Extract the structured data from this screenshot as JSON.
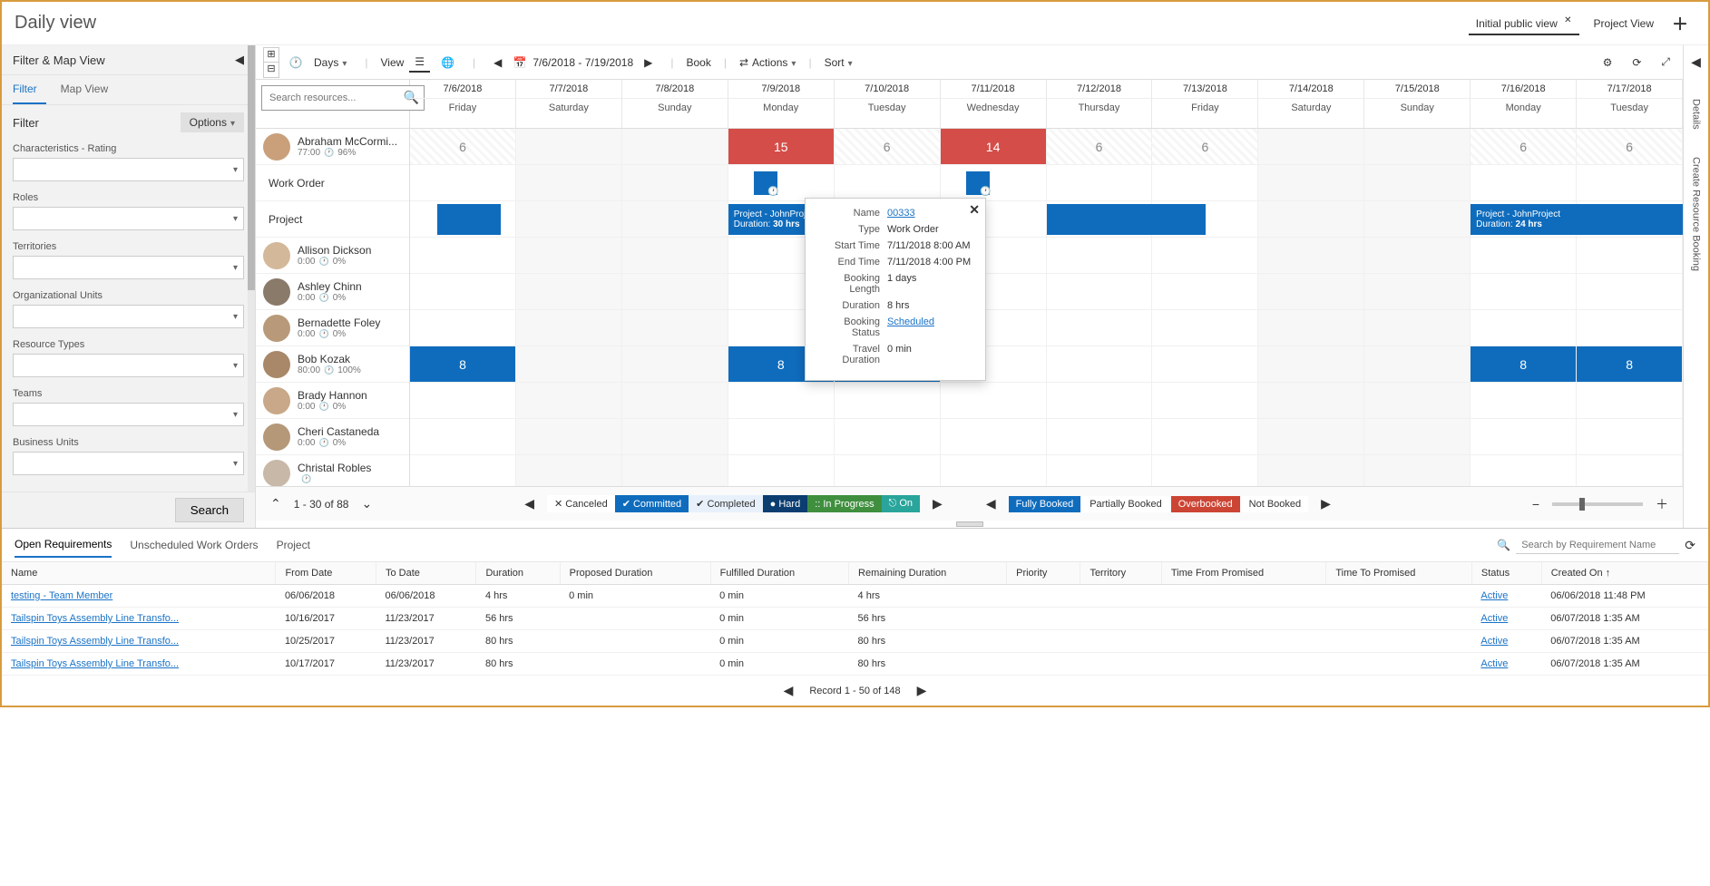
{
  "header": {
    "title": "Daily view",
    "tabs": [
      {
        "label": "Initial public view",
        "active": true,
        "closable": true
      },
      {
        "label": "Project View",
        "active": false,
        "closable": false
      }
    ]
  },
  "leftPanel": {
    "title": "Filter & Map View",
    "tabs": [
      "Filter",
      "Map View"
    ],
    "filterTitle": "Filter",
    "options": "Options",
    "groups": [
      "Characteristics - Rating",
      "Roles",
      "Territories",
      "Organizational Units",
      "Resource Types",
      "Teams",
      "Business Units"
    ],
    "searchBtn": "Search"
  },
  "toolbar": {
    "days": "Days",
    "view": "View",
    "dateRange": "7/6/2018 - 7/19/2018",
    "book": "Book",
    "actions": "Actions",
    "sort": "Sort"
  },
  "searchPlaceholder": "Search resources...",
  "dates": [
    {
      "d": "7/6/2018",
      "w": "Friday"
    },
    {
      "d": "7/7/2018",
      "w": "Saturday"
    },
    {
      "d": "7/8/2018",
      "w": "Sunday"
    },
    {
      "d": "7/9/2018",
      "w": "Monday"
    },
    {
      "d": "7/10/2018",
      "w": "Tuesday"
    },
    {
      "d": "7/11/2018",
      "w": "Wednesday"
    },
    {
      "d": "7/12/2018",
      "w": "Thursday"
    },
    {
      "d": "7/13/2018",
      "w": "Friday"
    },
    {
      "d": "7/14/2018",
      "w": "Saturday"
    },
    {
      "d": "7/15/2018",
      "w": "Sunday"
    },
    {
      "d": "7/16/2018",
      "w": "Monday"
    },
    {
      "d": "7/17/2018",
      "w": "Tuesday"
    }
  ],
  "resources": [
    {
      "name": "Abraham McCormi...",
      "hours": "77:00",
      "pct": "96%",
      "expanded": true,
      "avatar": "#c9a07a"
    },
    {
      "name": "Allison Dickson",
      "hours": "0:00",
      "pct": "0%",
      "avatar": "#d4b89a"
    },
    {
      "name": "Ashley Chinn",
      "hours": "0:00",
      "pct": "0%",
      "avatar": "#8a7a6a"
    },
    {
      "name": "Bernadette Foley",
      "hours": "0:00",
      "pct": "0%",
      "avatar": "#b89a7a"
    },
    {
      "name": "Bob Kozak",
      "hours": "80:00",
      "pct": "100%",
      "avatar": "#a88868"
    },
    {
      "name": "Brady Hannon",
      "hours": "0:00",
      "pct": "0%",
      "avatar": "#c8a888"
    },
    {
      "name": "Cheri Castaneda",
      "hours": "0:00",
      "pct": "0%",
      "avatar": "#b49878"
    },
    {
      "name": "Christal Robles",
      "hours": "",
      "pct": "",
      "avatar": "#c8b8a8"
    }
  ],
  "subRows": [
    "Work Order",
    "Project"
  ],
  "abrahamCounts": [
    "6",
    "",
    "",
    "15",
    "6",
    "14",
    "6",
    "6",
    "",
    "",
    "6",
    "6"
  ],
  "bobCounts": [
    "8",
    "",
    "",
    "8",
    "8",
    "",
    "",
    "",
    "",
    "",
    "8",
    "8"
  ],
  "projectBooking1": {
    "title": "Project - JohnProject",
    "dur": "Duration: ",
    "durVal": "30 hrs"
  },
  "projectBooking2": {
    "title": "Project - JohnProject",
    "dur": "Duration: ",
    "durVal": "24 hrs"
  },
  "tooltip": {
    "rows": [
      {
        "label": "Name",
        "val": "00333",
        "link": true
      },
      {
        "label": "Type",
        "val": "Work Order"
      },
      {
        "label": "Start Time",
        "val": "7/11/2018 8:00 AM"
      },
      {
        "label": "End Time",
        "val": "7/11/2018 4:00 PM"
      },
      {
        "label": "Booking Length",
        "val": "1 days"
      },
      {
        "label": "Duration",
        "val": "8 hrs"
      },
      {
        "label": "Booking Status",
        "val": "Scheduled",
        "link": true
      },
      {
        "label": "Travel Duration",
        "val": "0 min"
      }
    ]
  },
  "pager": {
    "text": "1 - 30 of 88"
  },
  "legend1": [
    {
      "label": "Canceled",
      "cls": "chip-cancel",
      "x": true
    },
    {
      "label": "Committed",
      "cls": "chip-committed",
      "check": true
    },
    {
      "label": "Completed",
      "cls": "chip-completed",
      "check": true
    },
    {
      "label": "Hard",
      "cls": "chip-hard",
      "dot": true
    },
    {
      "label": "In Progress",
      "cls": "chip-inprogress",
      "dots": true
    },
    {
      "label": "On",
      "cls": "chip-on",
      "icon": true
    }
  ],
  "legend2": [
    {
      "label": "Fully Booked",
      "cls": "chip-fully"
    },
    {
      "label": "Partially Booked",
      "cls": "chip-plain"
    },
    {
      "label": "Overbooked",
      "cls": "chip-over"
    },
    {
      "label": "Not Booked",
      "cls": "chip-plain"
    }
  ],
  "bottom": {
    "tabs": [
      "Open Requirements",
      "Unscheduled Work Orders",
      "Project"
    ],
    "searchPlaceholder": "Search by Requirement Name",
    "headers": [
      "Name",
      "From Date",
      "To Date",
      "Duration",
      "Proposed Duration",
      "Fulfilled Duration",
      "Remaining Duration",
      "Priority",
      "Territory",
      "Time From Promised",
      "Time To Promised",
      "Status",
      "Created On ↑"
    ],
    "rows": [
      {
        "name": "testing - Team Member",
        "from": "06/06/2018",
        "to": "06/06/2018",
        "dur": "4 hrs",
        "prop": "0 min",
        "ful": "0 min",
        "rem": "4 hrs",
        "status": "Active",
        "created": "06/06/2018 11:48 PM"
      },
      {
        "name": "Tailspin Toys Assembly Line Transfo...",
        "from": "10/16/2017",
        "to": "11/23/2017",
        "dur": "56 hrs",
        "prop": "",
        "ful": "0 min",
        "rem": "56 hrs",
        "status": "Active",
        "created": "06/07/2018 1:35 AM"
      },
      {
        "name": "Tailspin Toys Assembly Line Transfo...",
        "from": "10/25/2017",
        "to": "11/23/2017",
        "dur": "80 hrs",
        "prop": "",
        "ful": "0 min",
        "rem": "80 hrs",
        "status": "Active",
        "created": "06/07/2018 1:35 AM"
      },
      {
        "name": "Tailspin Toys Assembly Line Transfo...",
        "from": "10/17/2017",
        "to": "11/23/2017",
        "dur": "80 hrs",
        "prop": "",
        "ful": "0 min",
        "rem": "80 hrs",
        "status": "Active",
        "created": "06/07/2018 1:35 AM"
      }
    ],
    "pager": "Record 1 - 50 of 148"
  },
  "rightRail": [
    "Details",
    "Create Resource Booking"
  ]
}
